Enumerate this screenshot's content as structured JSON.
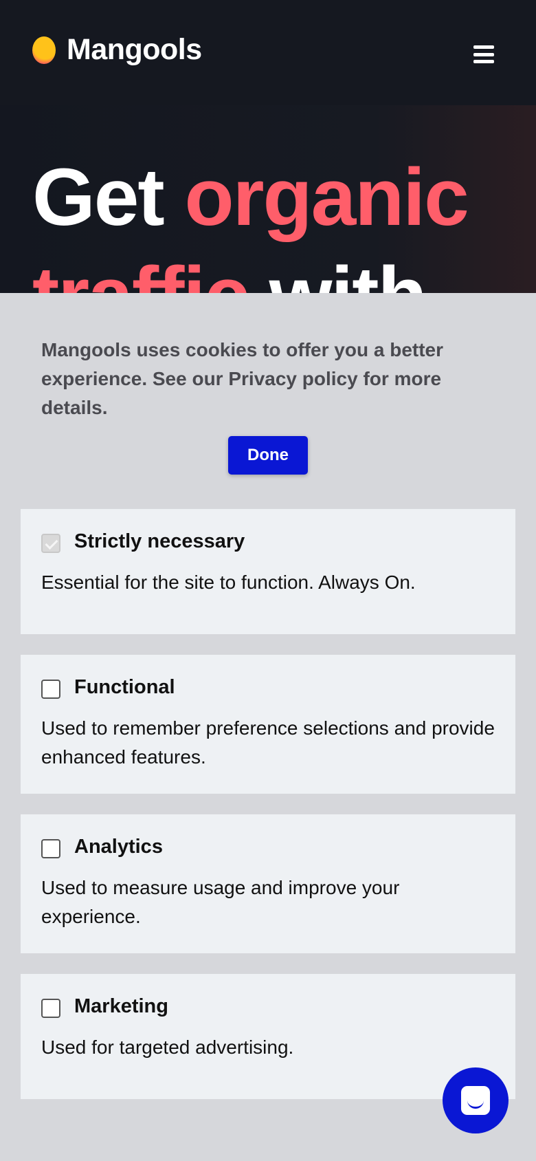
{
  "header": {
    "brand": "Mangools",
    "logo_icon": "mango-logo-icon",
    "menu_icon": "hamburger-menu-icon"
  },
  "hero": {
    "line1_white": "Get",
    "line1_accent": "organic",
    "line2_accent": "traffic",
    "line2_white": "with"
  },
  "cookie_banner": {
    "message": "Mangools uses cookies to offer you a better experience. See our Privacy policy for more details.",
    "done_label": "Done",
    "categories": [
      {
        "title": "Strictly necessary",
        "description": "Essential for the site to function. Always On.",
        "checked": true,
        "disabled": true
      },
      {
        "title": "Functional",
        "description": "Used to remember preference selections and provide enhanced features.",
        "checked": false,
        "disabled": false
      },
      {
        "title": "Analytics",
        "description": "Used to measure usage and improve your experience.",
        "checked": false,
        "disabled": false
      },
      {
        "title": "Marketing",
        "description": "Used for targeted advertising.",
        "checked": false,
        "disabled": false
      }
    ]
  },
  "chat_widget": {
    "icon": "chat-bubble-icon"
  },
  "colors": {
    "header_bg": "#151820",
    "accent": "#ff5e6a",
    "button_blue": "#0a17d4",
    "card_bg": "#eef1f4"
  }
}
